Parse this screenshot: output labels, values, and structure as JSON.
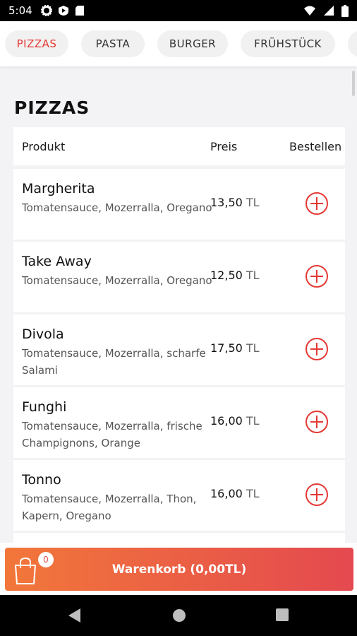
{
  "status_bar": {
    "time": "5:04",
    "left_icons": [
      "settings-icon",
      "play-shield-icon",
      "sd-card-icon"
    ],
    "right_icons": [
      "wifi-icon",
      "signal-icon",
      "battery-icon"
    ]
  },
  "tabs": [
    {
      "label": "PIZZAS",
      "active": true
    },
    {
      "label": "PASTA",
      "active": false
    },
    {
      "label": "BURGER",
      "active": false
    },
    {
      "label": "FRÜHSTÜCK",
      "active": false
    }
  ],
  "section": {
    "title": "PIZZAS"
  },
  "table": {
    "headers": {
      "product": "Produkt",
      "price": "Preis",
      "order": "Bestellen"
    },
    "items": [
      {
        "name": "Margherita",
        "description": "Tomatensauce, Mozerralla, Oregano",
        "price": "13,50",
        "currency": "TL"
      },
      {
        "name": "Take Away",
        "description": "Tomatensauce, Mozerralla, Oregano",
        "price": "12,50",
        "currency": "TL"
      },
      {
        "name": "Divola",
        "description": "Tomatensauce, Mozerralla, scharfe Salami",
        "price": "17,50",
        "currency": "TL"
      },
      {
        "name": "Funghi",
        "description": "Tomatensauce, Mozerralla, frische Champignons, Orange",
        "price": "16,00",
        "currency": "TL"
      },
      {
        "name": "Tonno",
        "description": "Tomatensauce, Mozerralla, Thon, Kapern, Oregano",
        "price": "16,00",
        "currency": "TL"
      }
    ]
  },
  "cart": {
    "label": "Warenkorb (0,00TL)",
    "count": "0"
  },
  "colors": {
    "accent": "#e53935",
    "cart_start": "#f2773a",
    "cart_end": "#e4494f"
  },
  "nav_bar": {
    "buttons": [
      "back-icon",
      "home-icon",
      "recents-icon"
    ]
  }
}
